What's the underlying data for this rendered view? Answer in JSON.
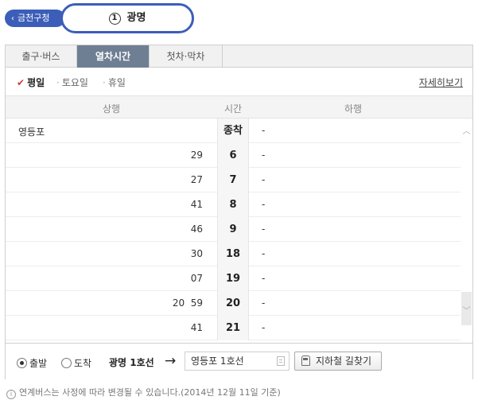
{
  "header": {
    "prev_station": "금천구청",
    "prev_chevron": "‹",
    "current_station_number": "1",
    "current_station": "광명"
  },
  "tabs": [
    {
      "label": "출구·버스",
      "active": false
    },
    {
      "label": "열차시간",
      "active": true
    },
    {
      "label": "첫차·막차",
      "active": false
    }
  ],
  "days": [
    {
      "label": "평일",
      "active": true
    },
    {
      "label": "토요일",
      "active": false
    },
    {
      "label": "휴일",
      "active": false
    }
  ],
  "detail_link": "자세히보기",
  "columns": {
    "up": "상행",
    "time": "시간",
    "down": "하행"
  },
  "rows": [
    {
      "up": "영등포",
      "hour": "종착",
      "down": "-"
    },
    {
      "up": "29",
      "hour": "6",
      "down": "-"
    },
    {
      "up": "27",
      "hour": "7",
      "down": "-"
    },
    {
      "up": "41",
      "hour": "8",
      "down": "-"
    },
    {
      "up": "46",
      "hour": "9",
      "down": "-"
    },
    {
      "up": "30",
      "hour": "18",
      "down": "-"
    },
    {
      "up": "07",
      "hour": "19",
      "down": "-"
    },
    {
      "up": "20  59",
      "hour": "20",
      "down": "-"
    },
    {
      "up": "41",
      "hour": "21",
      "down": "-"
    }
  ],
  "controls": {
    "radio_depart": "출발",
    "radio_arrive": "도착",
    "selected": "출발",
    "line_label": "광명 1호선",
    "arrow": "→",
    "destination": "영등포 1호선",
    "route_button": "지하철 길찾기"
  },
  "note": "연계버스는 사정에 따라 변경될 수 있습니다.(2014년 12월 11일 기준)",
  "colors": {
    "accent": "#3c5eb9",
    "active_tab": "#6e7f94",
    "check": "#d23b3b"
  }
}
